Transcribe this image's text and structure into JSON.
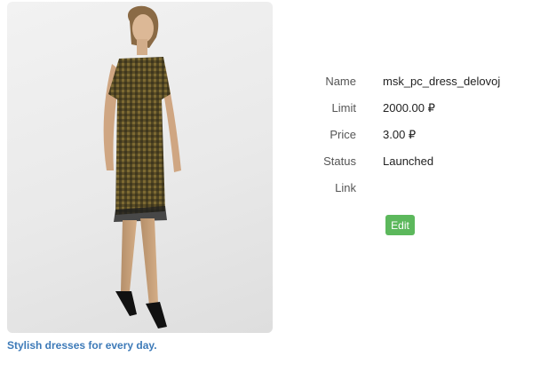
{
  "product": {
    "caption": "Stylish dresses for every day.",
    "image_alt": "woman-in-checked-dress",
    "fields": [
      {
        "label": "Name",
        "value": "msk_pc_dress_delovoj"
      },
      {
        "label": "Limit",
        "value": "2000.00 ₽"
      },
      {
        "label": "Price",
        "value": "3.00 ₽"
      },
      {
        "label": "Status",
        "value": "Launched"
      },
      {
        "label": "Link",
        "value": ""
      }
    ],
    "edit_label": "Edit"
  },
  "colors": {
    "caption_link": "#3d7ab8",
    "edit_button": "#5cb85c",
    "dress": "#6b5a2a"
  }
}
